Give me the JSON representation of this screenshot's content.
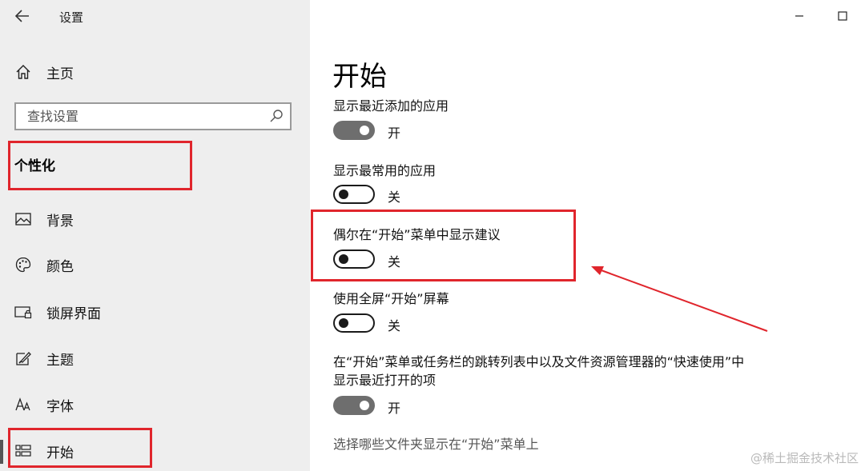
{
  "window": {
    "title": "设置",
    "back_icon": "arrow-left-icon",
    "controls": [
      "minimize-icon",
      "maximize-icon"
    ]
  },
  "sidebar": {
    "home_label": "主页",
    "search_placeholder": "查找设置",
    "section_title": "个性化",
    "items": [
      {
        "label": "背景",
        "icon": "image-icon"
      },
      {
        "label": "颜色",
        "icon": "palette-icon"
      },
      {
        "label": "锁屏界面",
        "icon": "lock-screen-icon"
      },
      {
        "label": "主题",
        "icon": "theme-brush-icon"
      },
      {
        "label": "字体",
        "icon": "font-icon"
      },
      {
        "label": "开始",
        "icon": "start-grid-icon",
        "selected": true
      }
    ]
  },
  "main": {
    "title": "开始",
    "settings": [
      {
        "label": "显示最近添加的应用",
        "state": "开",
        "on": true
      },
      {
        "label": "显示最常用的应用",
        "state": "关",
        "on": false
      },
      {
        "label": "偶尔在“开始”菜单中显示建议",
        "state": "关",
        "on": false
      },
      {
        "label": "使用全屏“开始”屏幕",
        "state": "关",
        "on": false
      },
      {
        "label_line1": "在“开始”菜单或任务栏的跳转列表中以及文件资源管理器的“快速使用”中",
        "label_line2": "显示最近打开的项",
        "state": "开",
        "on": true
      }
    ],
    "faded_label": "选择哪些文件夹显示在“开始”菜单上"
  },
  "annotation_color": "#e0252c",
  "watermark": "@稀土掘金技术社区"
}
